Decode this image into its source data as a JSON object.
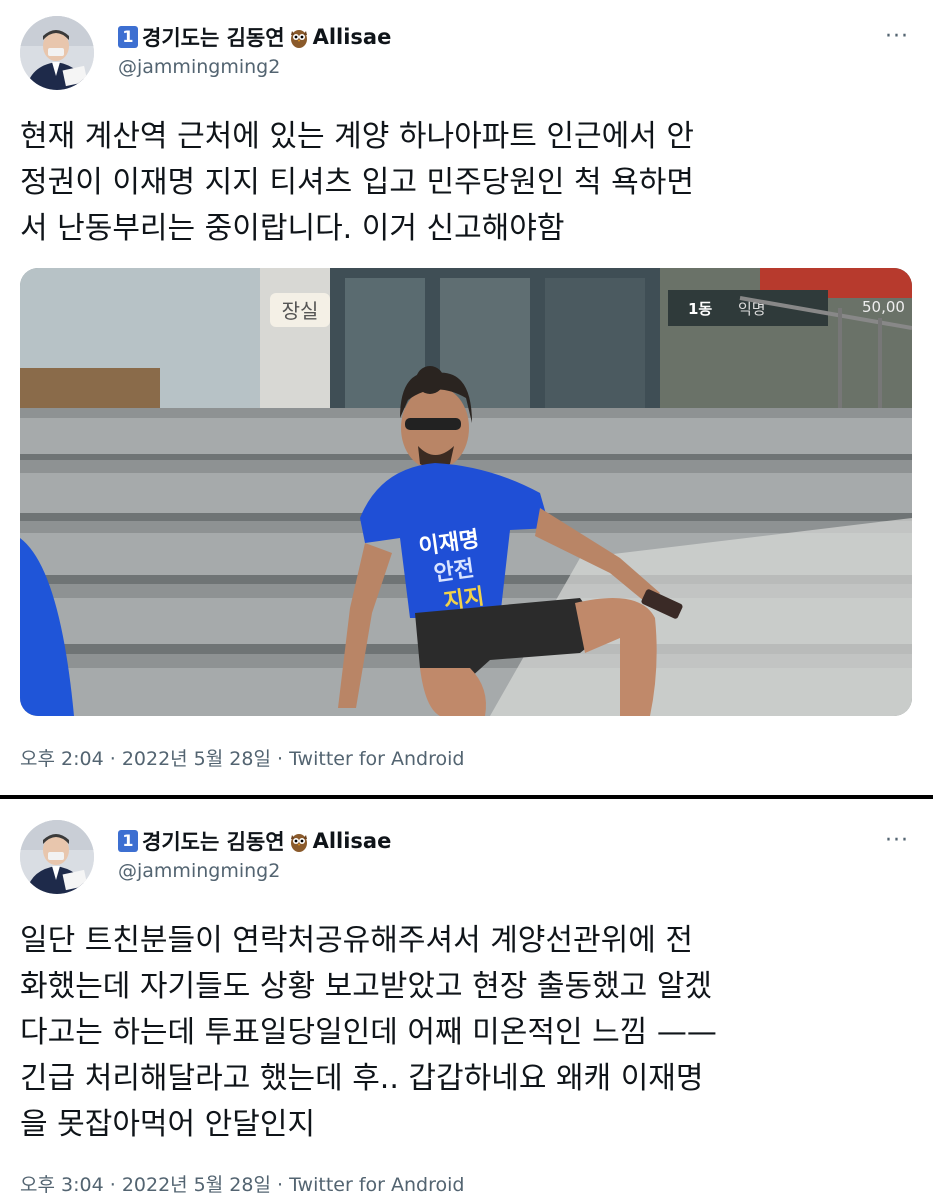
{
  "tweets": [
    {
      "user": {
        "rank_badge": "1",
        "display_name": "경기도는 김동연",
        "name_suffix": "Allisae",
        "handle": "@jammingming2"
      },
      "more_label": "···",
      "text": "현재 계산역 근처에 있는 계양 하나아파트 인근에서 안\n정권이 이재명 지지 티셔츠 입고 민주당원인 척 욕하면\n서 난동부리는 중이랍니다. 이거 신고해야함",
      "photo": {
        "sign_text": "장실",
        "banner_1": "1동",
        "banner_2": "익명",
        "banner_3": "50,00",
        "shirt_text": [
          "이재명",
          "안전",
          "지지"
        ]
      },
      "time": "오후 2:04",
      "date": "2022년 5월 28일",
      "separator": "·",
      "source": "Twitter for Android"
    },
    {
      "user": {
        "rank_badge": "1",
        "display_name": "경기도는 김동연",
        "name_suffix": "Allisae",
        "handle": "@jammingming2"
      },
      "more_label": "···",
      "text": "일단 트친분들이 연락처공유해주셔서 계양선관위에 전\n화했는데 자기들도 상황 보고받았고 현장 출동했고 알겠\n다고는 하는데 투표일당일인데 어째 미온적인 느낌 ——\n긴급 처리해달라고 했는데 후.. 갑갑하네요 왜캐 이재명\n을 못잡아먹어 안달인지",
      "time": "오후 3:04",
      "date": "2022년 5월 28일",
      "separator": "·",
      "source": "Twitter for Android"
    }
  ],
  "colors": {
    "text": "#0f1419",
    "secondary": "#536471",
    "badge": "#3d6fd1",
    "shirt": "#1f4fd6",
    "separator": "#000000"
  },
  "icons": [
    "owl-icon",
    "more-icon"
  ]
}
